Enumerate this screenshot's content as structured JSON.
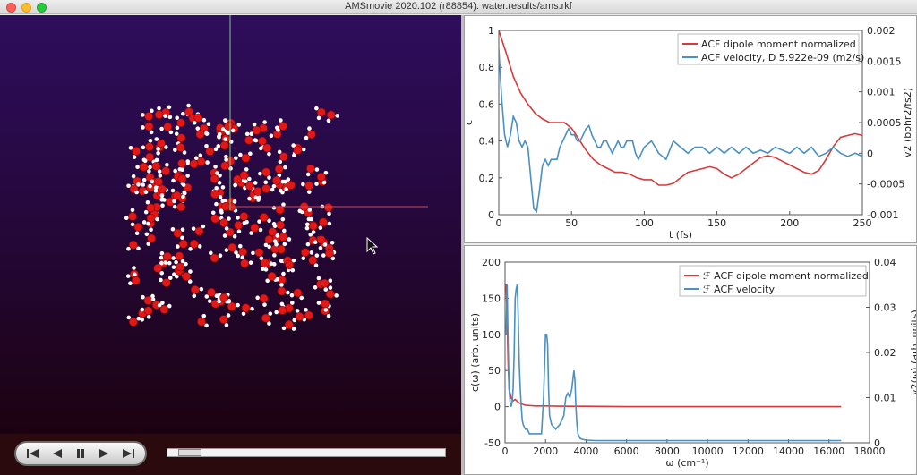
{
  "window": {
    "title": "AMSmovie 2020.102 (r88854): water.results/ams.rkf"
  },
  "player": {
    "buttons": [
      "first-frame",
      "previous-frame",
      "pause",
      "next-frame",
      "last-frame"
    ],
    "progress": 0.04
  },
  "colors": {
    "red_series": "#d63a3a",
    "blue_series": "#4a90c2",
    "oxygen": "#e01818",
    "hydrogen": "#ffffff"
  },
  "chart_data": [
    {
      "type": "line",
      "xlabel": "t (fs)",
      "ylabel": "c",
      "y2label": "v2 (bohr2/fs2)",
      "xlim": [
        0,
        250
      ],
      "ylim": [
        0,
        1
      ],
      "y2lim": [
        -0.001,
        0.002
      ],
      "xticks": [
        "0",
        "50",
        "100",
        "150",
        "200",
        "250"
      ],
      "yticks": [
        "0",
        "0.2",
        "0.4",
        "0.6",
        "0.8",
        "1"
      ],
      "y2ticks": [
        "-0.001",
        "-0.0005",
        "0",
        "0.0005",
        "0.001",
        "0.0015",
        "0.002"
      ],
      "legend_position": "top-right",
      "series": [
        {
          "name": "ACF dipole moment normalized",
          "axis": "left",
          "color": "#d63a3a",
          "x": [
            0,
            5,
            10,
            15,
            20,
            25,
            30,
            35,
            40,
            45,
            50,
            55,
            60,
            65,
            70,
            75,
            80,
            85,
            90,
            95,
            100,
            105,
            110,
            115,
            120,
            125,
            130,
            135,
            140,
            145,
            150,
            155,
            160,
            165,
            170,
            175,
            180,
            185,
            190,
            195,
            200,
            205,
            210,
            215,
            220,
            225,
            230,
            235,
            240,
            245,
            250
          ],
          "y": [
            1.0,
            0.88,
            0.75,
            0.66,
            0.6,
            0.55,
            0.52,
            0.5,
            0.5,
            0.5,
            0.47,
            0.41,
            0.35,
            0.3,
            0.27,
            0.25,
            0.23,
            0.23,
            0.22,
            0.2,
            0.19,
            0.19,
            0.16,
            0.16,
            0.17,
            0.2,
            0.23,
            0.24,
            0.25,
            0.26,
            0.25,
            0.22,
            0.2,
            0.22,
            0.25,
            0.28,
            0.31,
            0.32,
            0.31,
            0.29,
            0.27,
            0.25,
            0.23,
            0.22,
            0.24,
            0.3,
            0.37,
            0.42,
            0.43,
            0.44,
            0.43
          ]
        },
        {
          "name": "ACF velocity, D 5.922e-09 (m2/s)",
          "axis": "right",
          "color": "#4a90c2",
          "x": [
            0,
            2,
            4,
            6,
            8,
            10,
            12,
            14,
            16,
            18,
            20,
            22,
            24,
            26,
            28,
            30,
            32,
            34,
            36,
            38,
            40,
            42,
            44,
            46,
            48,
            50,
            52,
            54,
            56,
            58,
            60,
            62,
            64,
            66,
            68,
            70,
            72,
            74,
            76,
            78,
            80,
            82,
            84,
            86,
            88,
            90,
            92,
            94,
            96,
            98,
            100,
            105,
            110,
            115,
            120,
            125,
            130,
            135,
            140,
            145,
            150,
            155,
            160,
            165,
            170,
            175,
            180,
            185,
            190,
            195,
            200,
            205,
            210,
            215,
            220,
            225,
            230,
            235,
            240,
            245,
            250
          ],
          "y": [
            0.0017,
            0.0009,
            0.0003,
            0.0001,
            0.0003,
            0.0006,
            0.0005,
            0.0002,
            0.0001,
            0.0002,
            0.0001,
            -0.0004,
            -0.0009,
            -0.00095,
            -0.0006,
            -0.0002,
            -0.0001,
            -0.0002,
            -0.0001,
            -0.0001,
            -0.0001,
            0.0001,
            0.0002,
            0.0003,
            0.0004,
            0.0003,
            0.0003,
            0.0002,
            0.0002,
            0.0003,
            0.0004,
            0.00045,
            0.0003,
            0.0002,
            0.0001,
            0.0001,
            0.0002,
            0.0002,
            0.0001,
            0.0,
            0.0001,
            0.0002,
            0.0001,
            0.0001,
            0.0002,
            0.0002,
            0.0002,
            0.0,
            -0.0001,
            0.0,
            0.0001,
            0.0002,
            0.0,
            -0.0001,
            0.0002,
            0.0001,
            0.0,
            0.0001,
            0.0001,
            0.0,
            0.0001,
            0.0,
            0.0001,
            0.0,
            0.0001,
            0.0,
            5e-05,
            0.0,
            0.0001,
            5e-05,
            0.0,
            0.0001,
            0.0,
            0.0001,
            -5e-05,
            0.0,
            0.0001,
            0.0,
            -5e-05,
            0.0,
            -5e-05
          ]
        }
      ]
    },
    {
      "type": "line",
      "xlabel": "ω (cm⁻¹)",
      "ylabel": "c(ω) (arb. units)",
      "y2label": "v2(ω) (arb. units)",
      "xlim": [
        0,
        18000
      ],
      "ylim": [
        -50,
        200
      ],
      "y2lim": [
        0,
        0.04
      ],
      "xticks": [
        "0",
        "2000",
        "4000",
        "6000",
        "8000",
        "10000",
        "12000",
        "14000",
        "16000",
        "18000"
      ],
      "yticks": [
        "-50",
        "0",
        "50",
        "100",
        "150",
        "200"
      ],
      "y2ticks": [
        "0",
        "0.01",
        "0.02",
        "0.03",
        "0.04"
      ],
      "legend_position": "top-right",
      "series": [
        {
          "name": "ℱ ACF dipole moment normalized",
          "axis": "left",
          "color": "#d63a3a",
          "x": [
            50,
            100,
            150,
            200,
            300,
            400,
            500,
            700,
            1000,
            1500,
            2000,
            3000,
            4000,
            6000,
            8000,
            10000,
            12000,
            14000,
            16600
          ],
          "y": [
            170,
            120,
            60,
            25,
            12,
            8,
            10,
            5,
            2,
            1,
            1,
            0.5,
            0.5,
            0,
            0,
            0,
            0,
            0,
            0
          ]
        },
        {
          "name": "ℱ ACF velocity",
          "axis": "right",
          "color": "#4a90c2",
          "x": [
            50,
            100,
            150,
            200,
            250,
            300,
            350,
            400,
            450,
            500,
            550,
            600,
            650,
            700,
            750,
            800,
            850,
            900,
            1000,
            1100,
            1200,
            1400,
            1600,
            1800,
            1900,
            2000,
            2050,
            2100,
            2150,
            2200,
            2300,
            2500,
            2700,
            2900,
            3000,
            3100,
            3200,
            3300,
            3400,
            3450,
            3500,
            3550,
            3600,
            3700,
            3800,
            4000,
            4500,
            5000,
            8000,
            12000,
            16600
          ],
          "y": [
            0.024,
            0.035,
            0.022,
            0.012,
            0.009,
            0.008,
            0.009,
            0.012,
            0.02,
            0.032,
            0.034,
            0.035,
            0.028,
            0.018,
            0.012,
            0.008,
            0.005,
            0.004,
            0.003,
            0.003,
            0.002,
            0.002,
            0.002,
            0.002,
            0.01,
            0.024,
            0.024,
            0.022,
            0.012,
            0.006,
            0.004,
            0.003,
            0.004,
            0.006,
            0.01,
            0.011,
            0.01,
            0.012,
            0.016,
            0.014,
            0.008,
            0.004,
            0.002,
            0.001,
            0.0008,
            0.0006,
            0.0005,
            0.0005,
            0.0005,
            0.0005,
            0.0005
          ]
        }
      ]
    }
  ]
}
